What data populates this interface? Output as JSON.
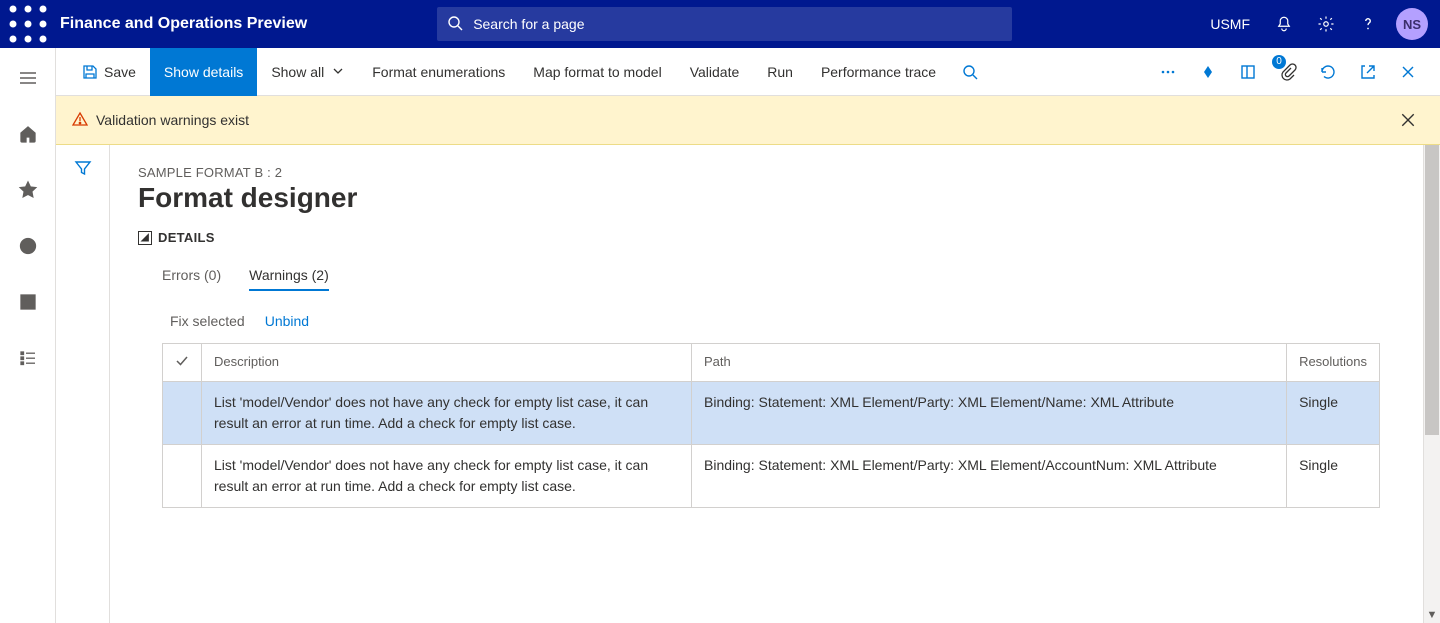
{
  "header": {
    "app_title": "Finance and Operations Preview",
    "search_placeholder": "Search for a page",
    "company": "USMF",
    "avatar": "NS"
  },
  "actionbar": {
    "save": "Save",
    "show_details": "Show details",
    "show_all": "Show all",
    "format_enumerations": "Format enumerations",
    "map_format": "Map format to model",
    "validate": "Validate",
    "run": "Run",
    "perf_trace": "Performance trace",
    "attachments_badge": "0"
  },
  "warning_banner": {
    "text": "Validation warnings exist"
  },
  "page": {
    "breadcrumb": "SAMPLE FORMAT B : 2",
    "title": "Format designer",
    "section": "DETAILS"
  },
  "tabs": {
    "errors": "Errors (0)",
    "warnings": "Warnings (2)"
  },
  "tab_actions": {
    "fix_selected": "Fix selected",
    "unbind": "Unbind"
  },
  "grid": {
    "headers": {
      "description": "Description",
      "path": "Path",
      "resolutions": "Resolutions"
    },
    "rows": [
      {
        "selected": true,
        "description": "List 'model/Vendor' does not have any check for empty list case, it can result an error at run time. Add a check for empty list case.",
        "path": "Binding: Statement: XML Element/Party: XML Element/Name: XML Attribute",
        "resolutions": "Single"
      },
      {
        "selected": false,
        "description": "List 'model/Vendor' does not have any check for empty list case, it can result an error at run time. Add a check for empty list case.",
        "path": "Binding: Statement: XML Element/Party: XML Element/AccountNum: XML Attribute",
        "resolutions": "Single"
      }
    ]
  }
}
